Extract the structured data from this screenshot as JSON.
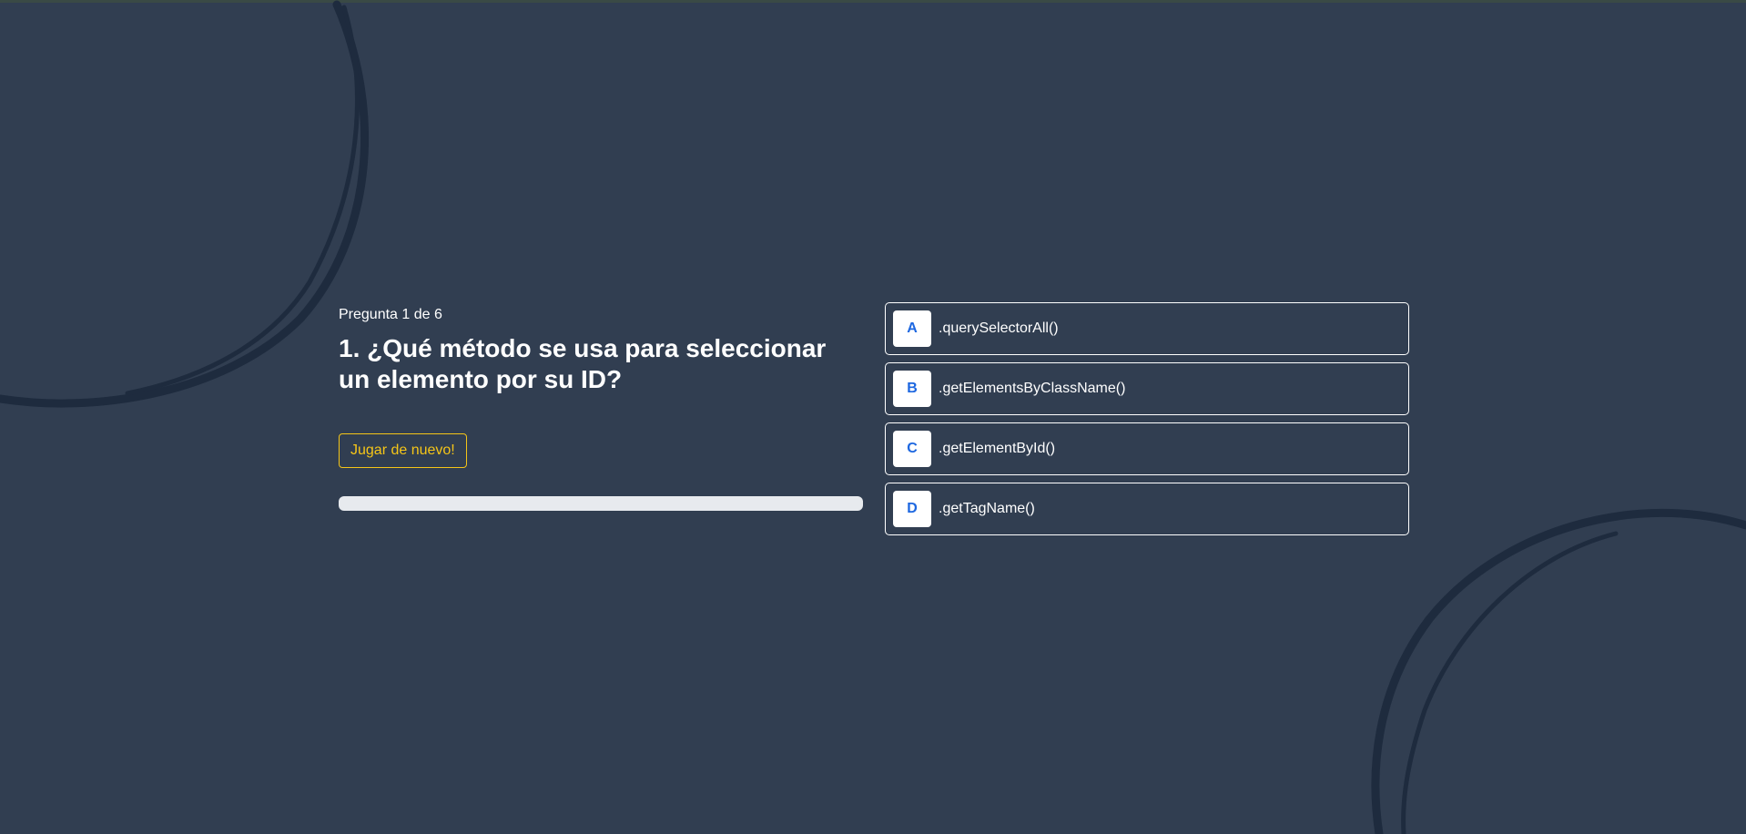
{
  "quiz": {
    "counter": "Pregunta 1 de 6",
    "question": "1. ¿Qué método se usa para seleccionar un elemento por su ID?",
    "replay_label": "Jugar de nuevo!",
    "progress": 0
  },
  "answers": [
    {
      "letter": "A",
      "text": ".querySelectorAll()"
    },
    {
      "letter": "B",
      "text": ".getElementsByClassName()"
    },
    {
      "letter": "C",
      "text": ".getElementById()"
    },
    {
      "letter": "D",
      "text": ".getTagName()"
    }
  ],
  "colors": {
    "background": "#313e51",
    "accent_button": "#f5c518",
    "letter_text": "#1d67e0",
    "progress_track": "#e7eaee",
    "decoration": "#1e2b3e"
  }
}
